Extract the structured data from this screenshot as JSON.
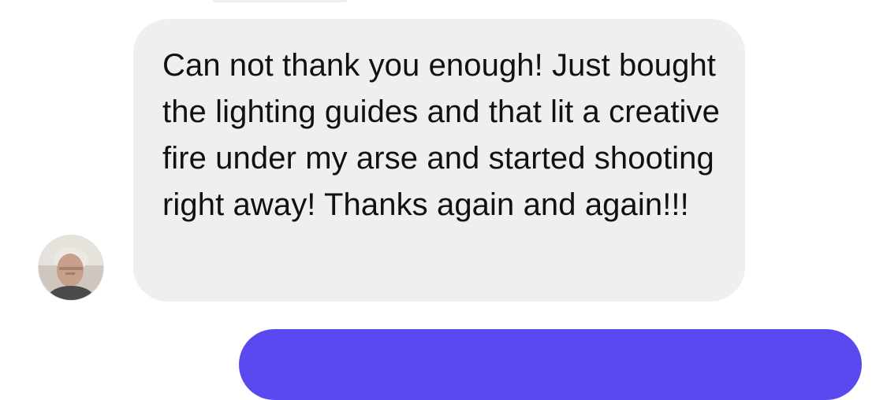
{
  "thread": {
    "incoming_message": {
      "text": "Can not thank you enough! Just bought the lighting guides and that lit a creative fire under my arse and started shooting right away! Thanks again and again!!!",
      "bubble_color": "#efeff0",
      "text_color": "#111111"
    },
    "sender_avatar": {
      "icon": "profile-photo"
    },
    "outgoing_message": {
      "bubble_color": "#5b49f0"
    }
  }
}
